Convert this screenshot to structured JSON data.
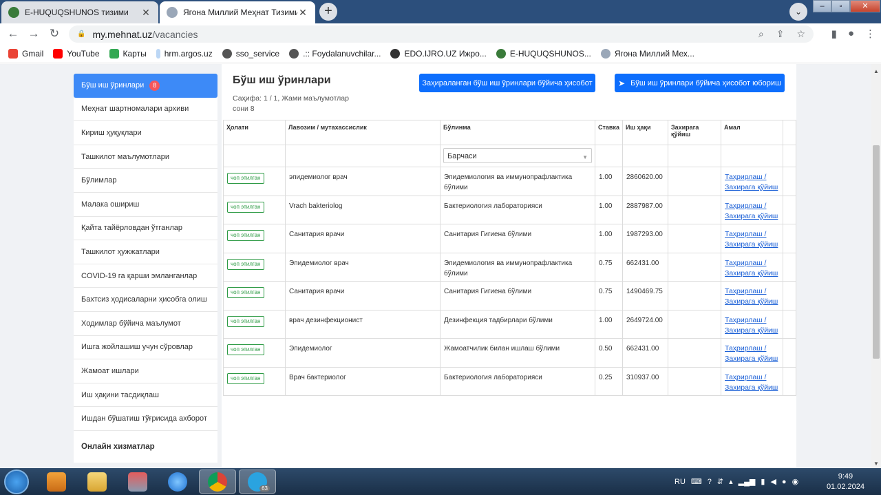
{
  "browser": {
    "tabs": [
      {
        "title": "E-HUQUQSHUNOS тизими",
        "active": false
      },
      {
        "title": "Ягона Миллий Меҳнат Тизими",
        "active": true
      }
    ],
    "url_host": "my.mehnat.uz",
    "url_path": "/vacancies",
    "bookmarks": [
      {
        "label": "Gmail",
        "icon": "gmail-icon"
      },
      {
        "label": "YouTube",
        "icon": "youtube-icon"
      },
      {
        "label": "Карты",
        "icon": "maps-icon"
      },
      {
        "label": "hrm.argos.uz",
        "icon": "argos-icon"
      },
      {
        "label": "sso_service",
        "icon": "globe-icon"
      },
      {
        "label": ".:: Foydalanuvchilar...",
        "icon": "globe-icon"
      },
      {
        "label": "EDO.IJRO.UZ Ижро...",
        "icon": "info-icon"
      },
      {
        "label": "E-HUQUQSHUNOS...",
        "icon": "emblem-icon"
      },
      {
        "label": "Ягона Миллий Мех...",
        "icon": "emblem-icon"
      }
    ]
  },
  "sidebar": {
    "items": [
      {
        "label": "Бўш иш ўринлари",
        "badge": "8",
        "active": true
      },
      {
        "label": "Меҳнат шартномалари архиви"
      },
      {
        "label": "Кириш ҳуқуқлари"
      },
      {
        "label": "Ташкилот маълумотлари"
      },
      {
        "label": "Бўлимлар"
      },
      {
        "label": "Малака ошириш"
      },
      {
        "label": "Қайта тайёрловдан ўтганлар"
      },
      {
        "label": "Ташкилот ҳужжатлари"
      },
      {
        "label": "COVID-19 га қарши эмланганлар"
      },
      {
        "label": "Бахтсиз ҳодисаларни ҳисобга олиш"
      },
      {
        "label": "Ходимлар бўйича маълумот"
      },
      {
        "label": "Ишга жойлашиш учун сўровлар"
      },
      {
        "label": "Жамоат ишлари"
      },
      {
        "label": "Иш ҳақини тасдиқлаш"
      },
      {
        "label": "Ишдан бўшатиш тўғрисида ахборот"
      }
    ],
    "section_header": "Онлайн хизматлар"
  },
  "main": {
    "title": "Бўш иш ўринлари",
    "page_info_line1": "Саҳифа: 1 / 1, Жами маълумотлар",
    "page_info_line2": "сони 8",
    "report_reserved_button": "Заҳираланган бўш иш ўринлари бўйича ҳисобот",
    "send_report_button": "Бўш иш ўринлари бўйича ҳисобот юбориш",
    "columns": {
      "status": "Ҳолати",
      "position": "Лавозим / мутахассислик",
      "department": "Бўлинма",
      "rate": "Ставка",
      "salary": "Иш ҳақи",
      "reserve": "Захирага қўйиш",
      "action": "Амал"
    },
    "filter_department": "Барчаси",
    "rows": [
      {
        "status": "чоп этилган",
        "position": "эпидемиолог врач",
        "department": "Эпидемиология ва иммунопрафлактика бўлими",
        "rate": "1.00",
        "salary": "2860620.00",
        "action1": "Таҳрирлаш /",
        "action2": "Захирага қўйиш"
      },
      {
        "status": "чоп этилган",
        "position": "Vrach bakteriolog",
        "department": "Бактериология лабораторияси",
        "rate": "1.00",
        "salary": "2887987.00",
        "action1": "Таҳрирлаш /",
        "action2": "Захирага қўйиш"
      },
      {
        "status": "чоп этилган",
        "position": "Санитария врачи",
        "department": "Санитария Гигиена бўлими",
        "rate": "1.00",
        "salary": "1987293.00",
        "action1": "Таҳрирлаш /",
        "action2": "Захирага қўйиш"
      },
      {
        "status": "чоп этилган",
        "position": "Эпидемиолог врач",
        "department": "Эпидемиология ва иммунопрафлактика бўлими",
        "rate": "0.75",
        "salary": "662431.00",
        "action1": "Таҳрирлаш /",
        "action2": "Захирага қўйиш"
      },
      {
        "status": "чоп этилган",
        "position": "Санитария врачи",
        "department": "Санитария Гигиена бўлими",
        "rate": "0.75",
        "salary": "1490469.75",
        "action1": "Таҳрирлаш /",
        "action2": "Захирага қўйиш"
      },
      {
        "status": "чоп этилган",
        "position": "врач дезинфекционист",
        "department": "Дезинфекция тадбирлари бўлими",
        "rate": "1.00",
        "salary": "2649724.00",
        "action1": "Таҳрирлаш /",
        "action2": "Захирага қўйиш"
      },
      {
        "status": "чоп этилган",
        "position": "Эпидемиолог",
        "department": "Жамоатчилик билан ишлаш бўлими",
        "rate": "0.50",
        "salary": "662431.00",
        "action1": "Таҳрирлаш /",
        "action2": "Захирага қўйиш"
      },
      {
        "status": "чоп этилган",
        "position": "Врач бактериолог",
        "department": "Бактериология лабораторияси",
        "rate": "0.25",
        "salary": "310937.00",
        "action1": "Таҳрирлаш /",
        "action2": "Захирага қўйиш"
      }
    ]
  },
  "taskbar": {
    "language": "RU",
    "time": "9:49",
    "date": "01.02.2024",
    "telegram_badge": "63"
  }
}
